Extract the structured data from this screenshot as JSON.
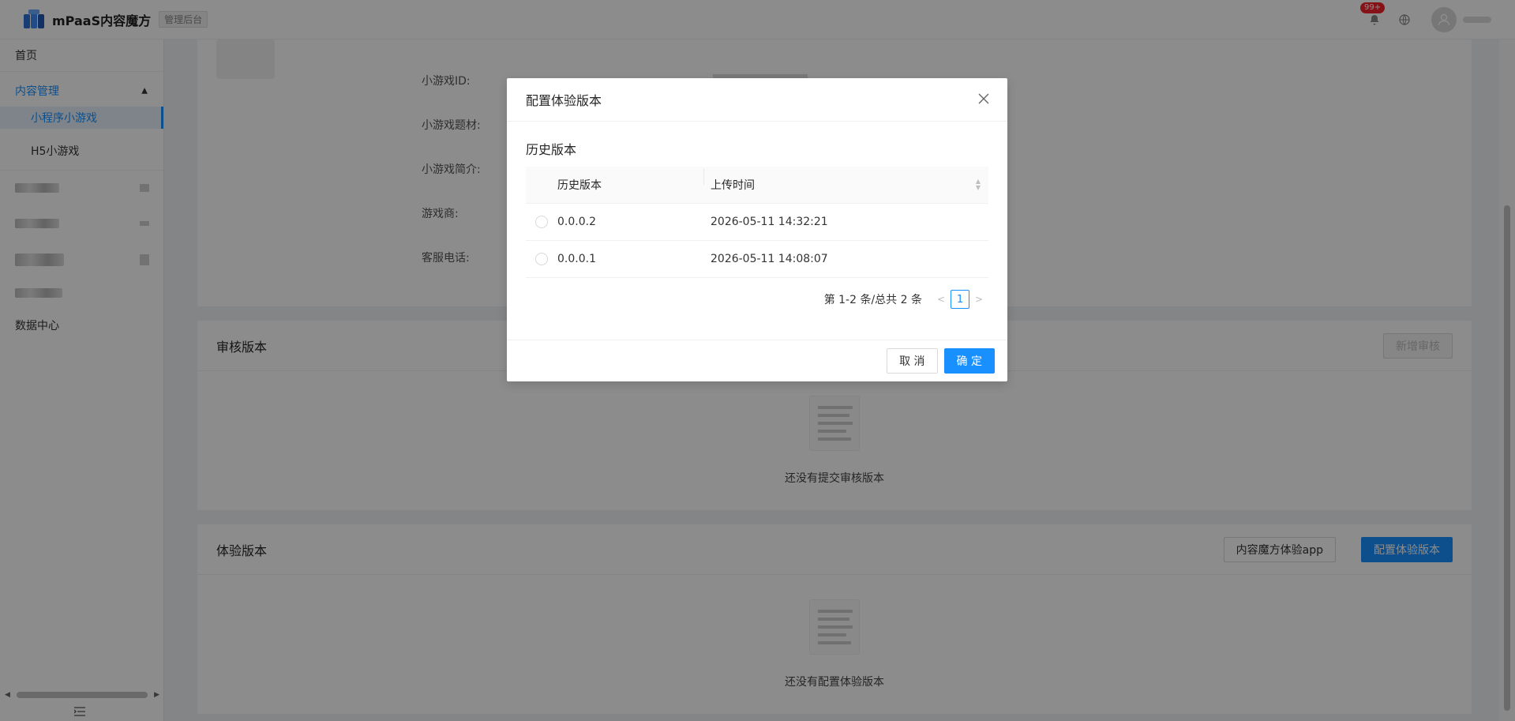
{
  "header": {
    "app_title": "mPaaS内容魔方",
    "admin_badge": "管理后台",
    "notification_count": "99+"
  },
  "sidebar": {
    "items": [
      {
        "label": "首页"
      },
      {
        "label": "内容管理"
      },
      {
        "label": "小程序小游戏"
      },
      {
        "label": "H5小游戏"
      },
      {
        "label": "数据中心"
      }
    ]
  },
  "detail": {
    "fields": [
      {
        "label": "小游戏ID:"
      },
      {
        "label": "小游戏题材:"
      },
      {
        "label": "小游戏简介:"
      },
      {
        "label": "游戏商:"
      },
      {
        "label": "客服电话:"
      }
    ]
  },
  "review_card": {
    "title": "审核版本",
    "add_button": "新增审核",
    "empty_text": "还没有提交审核版本"
  },
  "trial_card": {
    "title": "体验版本",
    "app_button": "内容魔方体验app",
    "config_button": "配置体验版本",
    "empty_text": "还没有配置体验版本"
  },
  "modal": {
    "title": "配置体验版本",
    "section_title": "历史版本",
    "columns": [
      "历史版本",
      "上传时间"
    ],
    "rows": [
      {
        "version": "0.0.0.2",
        "time": "2026-05-11 14:32:21"
      },
      {
        "version": "0.0.0.1",
        "time": "2026-05-11 14:08:07"
      }
    ],
    "pagination_text": "第 1-2 条/总共 2 条",
    "current_page": "1",
    "cancel_label": "取 消",
    "ok_label": "确 定"
  },
  "colors": {
    "primary": "#1890ff",
    "badge": "#f5222d"
  }
}
